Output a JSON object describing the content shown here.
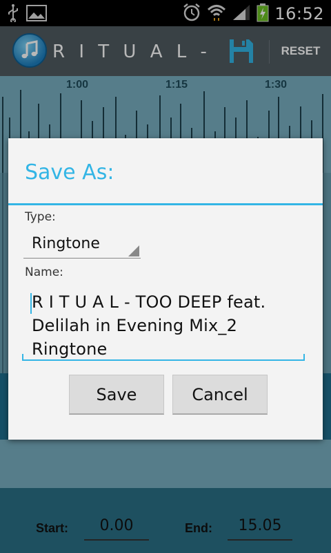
{
  "status_bar": {
    "time": "16:52",
    "icons": [
      "usb-icon",
      "image-icon",
      "alarm-icon",
      "wifi-icon",
      "signal-icon",
      "battery-charging-icon"
    ]
  },
  "action_bar": {
    "title": "R I T U A L - TOO…",
    "reset_label": "RESET",
    "icons": [
      "music-note-icon",
      "save-icon"
    ]
  },
  "timeline": {
    "ticks": [
      "1:00",
      "1:15",
      "1:30"
    ]
  },
  "bottom_bar": {
    "start_label": "Start:",
    "start_value": "0.00",
    "end_label": "End:",
    "end_value": "15.05"
  },
  "dialog": {
    "title": "Save As:",
    "type_label": "Type:",
    "type_value": "Ringtone",
    "name_label": "Name:",
    "name_value": "R I T U A L - TOO DEEP feat. Delilah in Evening Mix_2 Ringtone",
    "save_button": "Save",
    "cancel_button": "Cancel"
  },
  "colors": {
    "accent": "#33b5e5",
    "action_bar": "#4f5a60",
    "waveform_bg": "#78aebf",
    "selection": "#1f6f8f"
  }
}
